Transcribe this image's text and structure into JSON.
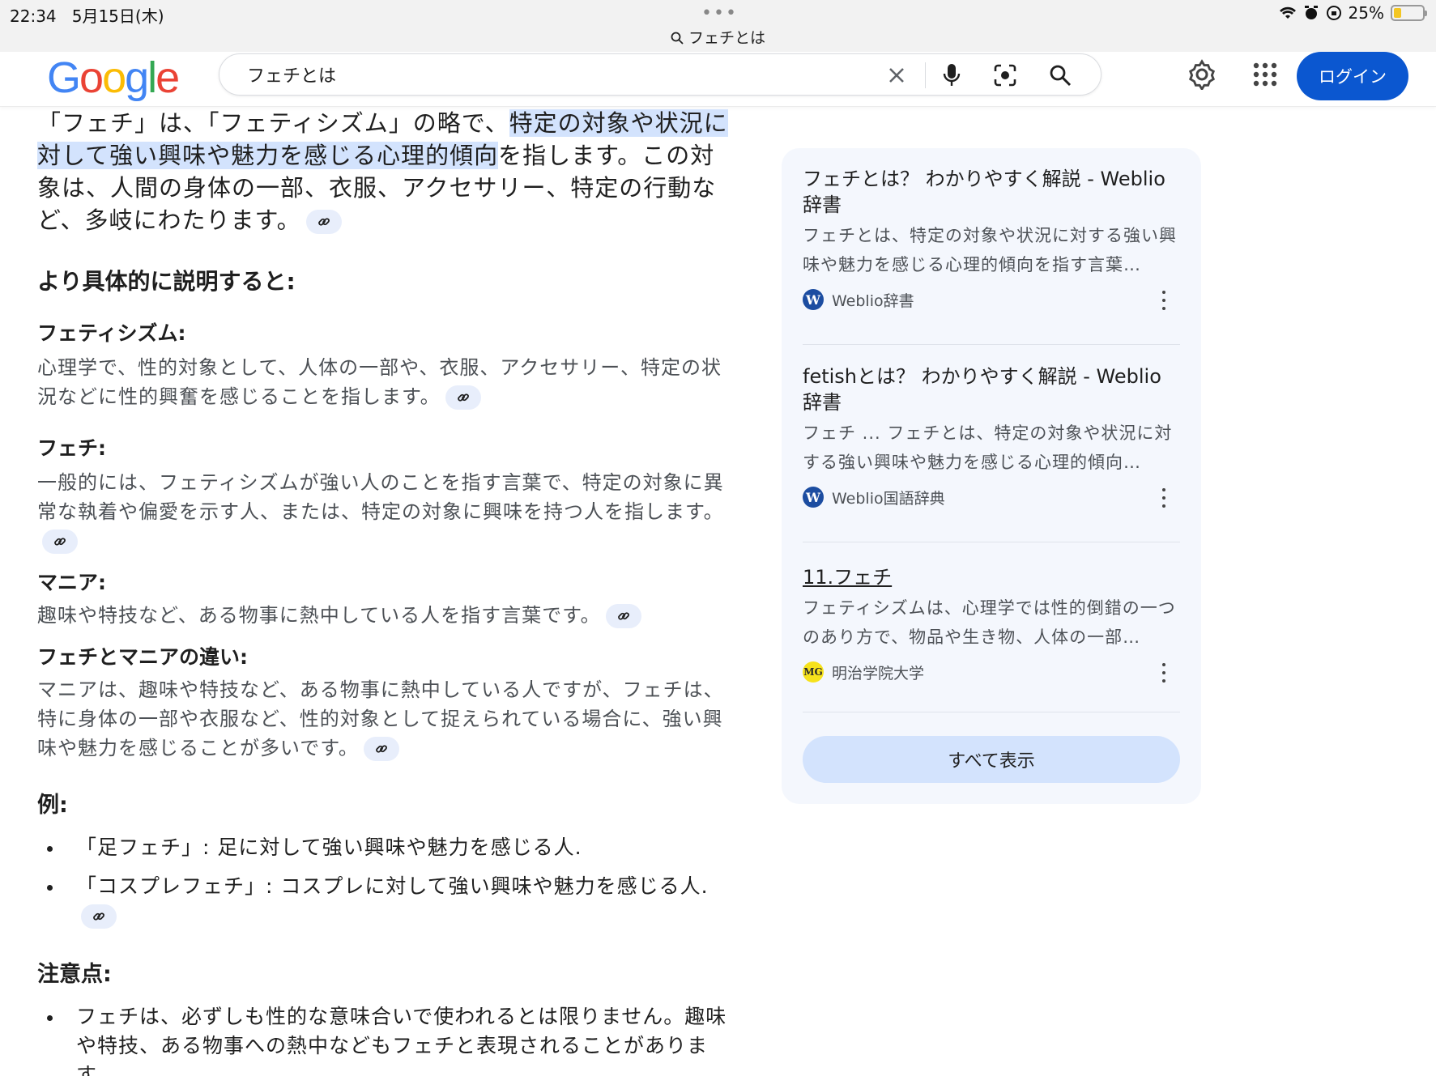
{
  "status": {
    "time": "22:34",
    "date": "5月15日(木)",
    "battery": "25%",
    "battery_level": 0.25,
    "url_text": "フェチとは"
  },
  "header": {
    "logo": [
      "G",
      "o",
      "o",
      "g",
      "l",
      "e"
    ],
    "logo_colors": [
      "#4285f4",
      "#ea4335",
      "#fbbc05",
      "#4285f4",
      "#34a853",
      "#ea4335"
    ],
    "search_value": "フェチとは",
    "login_label": "ログイン"
  },
  "answer": {
    "lead_pre": "「フェチ」は、「フェティシズム」の略で、",
    "lead_highlight": "特定の対象や状況に対して強い興味や魅力を感じる心理的傾向",
    "lead_post": "を指します。この対象は、人間の身体の一部、衣服、アクセサリー、特定の行動など、多岐にわたります。",
    "subheading": "より具体的に説明すると:",
    "terms": [
      {
        "term": "フェティシズム:",
        "desc": "心理学で、性的対象として、人体の一部や、衣服、アクセサリー、特定の状況などに性的興奮を感じることを指します。"
      },
      {
        "term": "フェチ:",
        "desc": "一般的には、フェティシズムが強い人のことを指す言葉で、特定の対象に異常な執着や偏愛を示す人、または、特定の対象に興味を持つ人を指します。"
      },
      {
        "term": "マニア:",
        "desc": "趣味や特技など、ある物事に熱中している人を指す言葉です。"
      },
      {
        "term": "フェチとマニアの違い:",
        "desc": "マニアは、趣味や特技など、ある物事に熱中している人ですが、フェチは、特に身体の一部や衣服など、性的対象として捉えられている場合に、強い興味や魅力を感じることが多いです。"
      }
    ],
    "examples_heading": "例:",
    "examples": [
      "「足フェチ」: 足に対して強い興味や魅力を感じる人.",
      "「コスプレフェチ」: コスプレに対して強い興味や魅力を感じる人."
    ],
    "notes_heading": "注意点:",
    "notes": [
      "フェチは、必ずしも性的な意味合いで使われるとは限りません。趣味や特技、ある物事への熱中などもフェチと表現されることがあります。"
    ]
  },
  "sources": {
    "items": [
      {
        "title": "フェチとは？ わかりやすく解説 - Weblio辞書",
        "snippet": "フェチとは、特定の対象や状況に対する強い興味や魅力を感じる心理的傾向を指す言葉…",
        "site": "Weblio辞書",
        "logo_text": "W"
      },
      {
        "title": "fetishとは？ わかりやすく解説 - Weblio辞書",
        "snippet": "フェチ ... フェチとは、特定の対象や状況に対する強い興味や魅力を感じる心理的傾向…",
        "site": "Weblio国語辞典",
        "logo_text": "W"
      },
      {
        "title": "11.フェチ",
        "snippet": "フェティシズムは、心理学では性的倒錯の一つのあり方で、物品や生き物、人体の一部…",
        "site": "明治学院大学",
        "logo_text": "MG"
      }
    ],
    "show_all_label": "すべて表示"
  }
}
